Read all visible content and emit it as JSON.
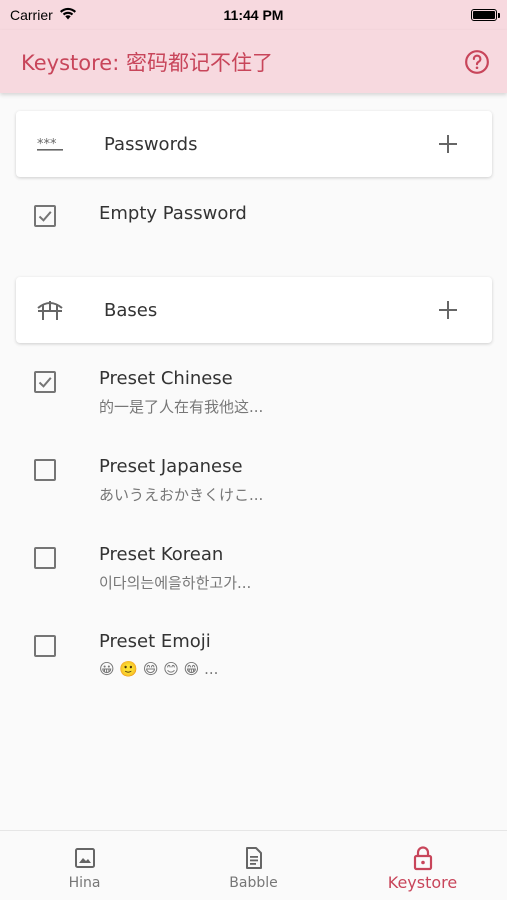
{
  "status_bar": {
    "carrier": "Carrier",
    "time": "11:44 PM"
  },
  "app_bar": {
    "title": "Keystore: 密码都记不住了"
  },
  "sections": [
    {
      "label": "Passwords",
      "icon": "password-dots-icon",
      "items": [
        {
          "title": "Empty Password",
          "subtitle": "",
          "checked": true
        }
      ]
    },
    {
      "label": "Bases",
      "icon": "bridge-icon",
      "items": [
        {
          "title": "Preset Chinese",
          "subtitle": "的一是了人在有我他这...",
          "checked": true
        },
        {
          "title": "Preset Japanese",
          "subtitle": "あいうえおかきくけこ...",
          "checked": false
        },
        {
          "title": "Preset Korean",
          "subtitle": "이다의는에을하한고가...",
          "checked": false
        },
        {
          "title": "Preset Emoji",
          "subtitle": "😀 🙂 😄 😊 😁 ...",
          "checked": false
        }
      ]
    }
  ],
  "bottom_nav": [
    {
      "label": "Hina",
      "icon": "image-icon",
      "active": false
    },
    {
      "label": "Babble",
      "icon": "document-icon",
      "active": false
    },
    {
      "label": "Keystore",
      "icon": "lock-icon",
      "active": true
    }
  ],
  "colors": {
    "accent": "#c8455a",
    "app_bar_bg": "#f7d9df"
  }
}
